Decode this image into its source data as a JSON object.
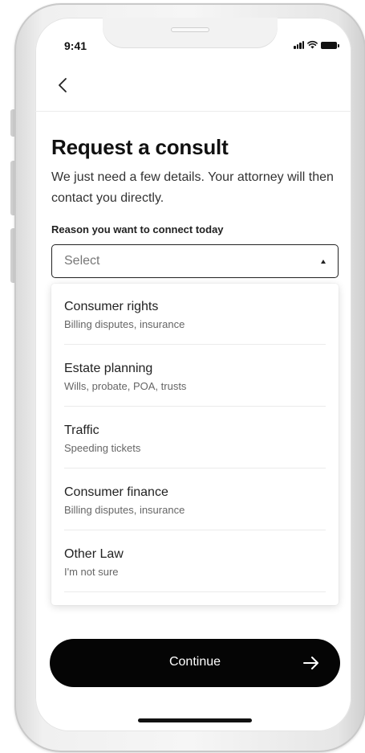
{
  "status_bar": {
    "time": "9:41",
    "icons": [
      "cellular-signal-icon",
      "wifi-icon",
      "battery-icon"
    ]
  },
  "nav": {
    "back_icon": "chevron-left-icon"
  },
  "page": {
    "title": "Request a consult",
    "subtitle": "We just need a few details. Your attorney will then contact you directly."
  },
  "form": {
    "reason_label": "Reason you want to connect today",
    "select_placeholder": "Select",
    "select_icon": "caret-up-icon",
    "options": [
      {
        "title": "Consumer rights",
        "description": "Billing disputes, insurance"
      },
      {
        "title": "Estate planning",
        "description": "Wills, probate, POA, trusts"
      },
      {
        "title": "Traffic",
        "description": "Speeding tickets"
      },
      {
        "title": "Consumer finance",
        "description": "Billing disputes, insurance"
      },
      {
        "title": "Other Law",
        "description": "I'm not sure"
      }
    ]
  },
  "footer": {
    "continue_label": "Continue",
    "continue_icon": "arrow-right-icon"
  },
  "colors": {
    "primary_button": "#050505",
    "text_primary": "#111111",
    "text_secondary": "#666666"
  }
}
